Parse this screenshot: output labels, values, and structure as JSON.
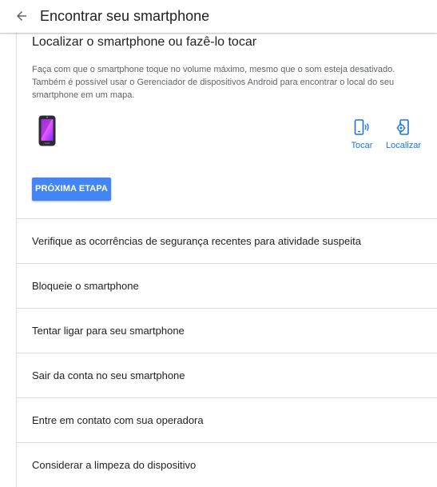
{
  "header": {
    "title": "Encontrar seu smartphone",
    "back_icon": "arrow-left-icon"
  },
  "expanded_step": {
    "title": "Localizar o smartphone ou fazê-lo tocar",
    "description": "Faça com que o smartphone toque no volume máximo, mesmo que o som esteja desativado. Também é possível usar o Gerenciador de dispositivos Android para encontrar o local do seu smartphone em um mapa.",
    "device_icon": "smartphone-icon",
    "actions": [
      {
        "label": "Tocar",
        "icon": "phone-ring-icon"
      },
      {
        "label": "Localizar",
        "icon": "phone-location-icon"
      }
    ],
    "next_button_label": "PRÓXIMA ETAPA"
  },
  "steps": [
    {
      "label": "Verifique as ocorrências de segurança recentes para atividade suspeita"
    },
    {
      "label": "Bloqueie o smartphone"
    },
    {
      "label": "Tentar ligar para seu smartphone"
    },
    {
      "label": "Sair da conta no seu smartphone"
    },
    {
      "label": "Entre em contato com sua operadora"
    },
    {
      "label": "Considerar a limpeza do dispositivo"
    }
  ],
  "colors": {
    "accent": "#1a73e8",
    "button": "#4285f4",
    "text": "#202124",
    "secondary_text": "#5f6368",
    "divider": "#e0e0e0"
  }
}
